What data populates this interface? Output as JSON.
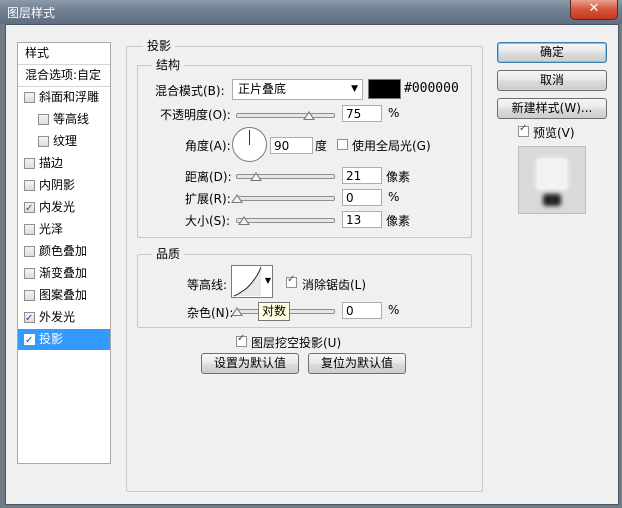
{
  "window": {
    "title": "图层样式",
    "close_glyph": "✕"
  },
  "style_list": {
    "header": "样式",
    "blend_options": "混合选项:自定",
    "items": [
      {
        "label": "斜面和浮雕",
        "checked": false,
        "indent": false
      },
      {
        "label": "等高线",
        "checked": false,
        "indent": true
      },
      {
        "label": "纹理",
        "checked": false,
        "indent": true
      },
      {
        "label": "描边",
        "checked": false,
        "indent": false
      },
      {
        "label": "内阴影",
        "checked": false,
        "indent": false
      },
      {
        "label": "内发光",
        "checked": true,
        "indent": false
      },
      {
        "label": "光泽",
        "checked": false,
        "indent": false
      },
      {
        "label": "颜色叠加",
        "checked": false,
        "indent": false
      },
      {
        "label": "渐变叠加",
        "checked": false,
        "indent": false
      },
      {
        "label": "图案叠加",
        "checked": false,
        "indent": false
      },
      {
        "label": "外发光",
        "checked": true,
        "indent": false
      },
      {
        "label": "投影",
        "checked": true,
        "indent": false,
        "selected": true
      }
    ]
  },
  "drop_shadow": {
    "title": "投影",
    "structure": {
      "title": "结构",
      "blend_mode_label": "混合模式(B):",
      "blend_mode_value": "正片叠底",
      "color_hex": "#000000",
      "opacity_label": "不透明度(O):",
      "opacity_value": "75",
      "opacity_unit": "%",
      "opacity_fraction": 0.75,
      "angle_label": "角度(A):",
      "angle_value": "90",
      "angle_unit": "度",
      "global_light_label": "使用全局光(G)",
      "global_light_checked": false,
      "distance_label": "距离(D):",
      "distance_value": "21",
      "distance_unit": "像素",
      "spread_label": "扩展(R):",
      "spread_value": "0",
      "spread_unit": "%",
      "size_label": "大小(S):",
      "size_value": "13",
      "size_unit": "像素"
    },
    "quality": {
      "title": "品质",
      "contour_label": "等高线:",
      "anti_alias_label": "消除锯齿(L)",
      "anti_alias_checked": true,
      "noise_label": "杂色(N):",
      "noise_value": "0",
      "noise_unit": "%",
      "tooltip": "对数"
    },
    "knockout_label": "图层挖空投影(U)",
    "knockout_checked": true,
    "make_default": "设置为默认值",
    "reset_default": "复位为默认值"
  },
  "buttons": {
    "ok": "确定",
    "cancel": "取消",
    "new_style": "新建样式(W)...",
    "preview_label": "预览(V)",
    "preview_checked": true
  },
  "colors": {
    "selection": "#3399ff",
    "shadow_color": "#000000"
  }
}
